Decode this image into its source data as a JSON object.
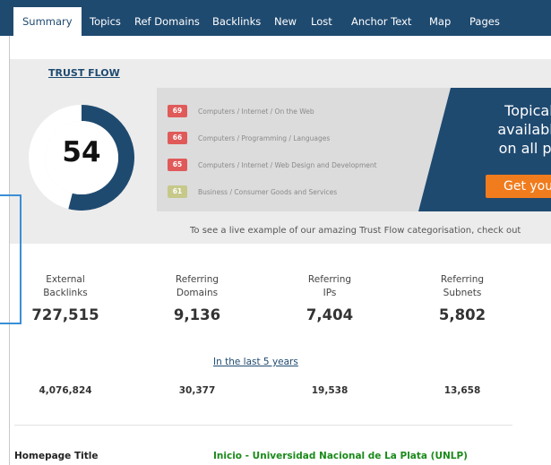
{
  "tabs": [
    {
      "label": "Summary",
      "active": true
    },
    {
      "label": "Topics"
    },
    {
      "label": "Ref Domains"
    },
    {
      "label": "Backlinks"
    },
    {
      "label": "New"
    },
    {
      "label": "Lost"
    },
    {
      "label": "Anchor Text"
    },
    {
      "label": "Map"
    },
    {
      "label": "Pages"
    }
  ],
  "trust_flow": {
    "title": "TRUST FLOW",
    "value": "54",
    "fraction": 0.54
  },
  "topics": [
    {
      "score": "69",
      "label": "Computers / Internet / On the Web",
      "color": "#e05a5a"
    },
    {
      "score": "66",
      "label": "Computers / Programming / Languages",
      "color": "#e05a5a"
    },
    {
      "score": "65",
      "label": "Computers / Internet / Web Design and Development",
      "color": "#e05a5a"
    },
    {
      "score": "61",
      "label": "Business / Consumer Goods and Services",
      "color": "#c6c98a"
    }
  ],
  "promo": {
    "line1": "Topical Tru",
    "line2": "available for",
    "line3": "on all paid s",
    "button": "Get you"
  },
  "live_note": "To see a live example of our amazing Trust Flow categorisation, check out",
  "stats": [
    {
      "label_line1": "External",
      "label_line2": "Backlinks",
      "value": "727,515",
      "history": "4,076,824"
    },
    {
      "label_line1": "Referring",
      "label_line2": "Domains",
      "value": "9,136",
      "history": "30,377"
    },
    {
      "label_line1": "Referring",
      "label_line2": "IPs",
      "value": "7,404",
      "history": "19,538"
    },
    {
      "label_line1": "Referring",
      "label_line2": "Subnets",
      "value": "5,802",
      "history": "13,658"
    }
  ],
  "period_link": "In the last 5 years",
  "homepage": {
    "label": "Homepage Title",
    "value": "Inicio - Universidad Nacional de La Plata (UNLP)"
  },
  "colors": {
    "nav": "#1f4a70",
    "accent_orange": "#f07c1e",
    "title_green": "#1a8a1a"
  }
}
